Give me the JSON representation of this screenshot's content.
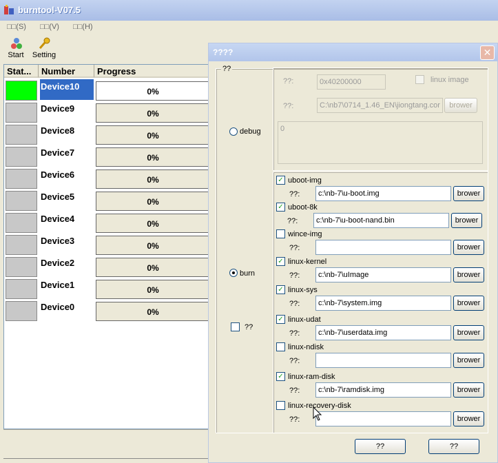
{
  "window": {
    "title": "burntool-V07.5"
  },
  "menu": [
    "□□(S)",
    "□□(V)",
    "□□(H)"
  ],
  "toolbar": {
    "start": "Start",
    "setting": "Setting"
  },
  "table": {
    "headers": [
      "Stat...",
      "Number",
      "Progress"
    ],
    "rows": [
      {
        "name": "Device10",
        "progress": "0%",
        "status_color": "#00ff00"
      },
      {
        "name": "Device9",
        "progress": "0%",
        "status_color": "#c8c8c8"
      },
      {
        "name": "Device8",
        "progress": "0%",
        "status_color": "#c8c8c8"
      },
      {
        "name": "Device7",
        "progress": "0%",
        "status_color": "#c8c8c8"
      },
      {
        "name": "Device6",
        "progress": "0%",
        "status_color": "#c8c8c8"
      },
      {
        "name": "Device5",
        "progress": "0%",
        "status_color": "#c8c8c8"
      },
      {
        "name": "Device4",
        "progress": "0%",
        "status_color": "#c8c8c8"
      },
      {
        "name": "Device3",
        "progress": "0%",
        "status_color": "#c8c8c8"
      },
      {
        "name": "Device2",
        "progress": "0%",
        "status_color": "#c8c8c8"
      },
      {
        "name": "Device1",
        "progress": "0%",
        "status_color": "#c8c8c8"
      },
      {
        "name": "Device0",
        "progress": "0%",
        "status_color": "#c8c8c8"
      }
    ]
  },
  "dialog": {
    "title": "????",
    "group_label": "??",
    "debug": {
      "radio_label": "debug",
      "addr_label": "??:",
      "addr_value": "0x40200000",
      "linux_image_label": "linux image",
      "path_label": "??:",
      "path_value": "C:\\nb7\\0714_1.46_EN\\jiongtang.cor",
      "browse_label": "brower",
      "log_value": "0"
    },
    "burn": {
      "radio_label": "burn",
      "extra_check_label": "??",
      "path_label": "??:",
      "browse_label": "brower",
      "items": [
        {
          "label": "uboot-img",
          "checked": true,
          "path": "c:\\nb-7\\u-boot.img"
        },
        {
          "label": "uboot-8k",
          "checked": true,
          "path": "c:\\nb-7\\u-boot-nand.bin"
        },
        {
          "label": "wince-img",
          "checked": false,
          "path": ""
        },
        {
          "label": "linux-kernel",
          "checked": true,
          "path": "c:\\nb-7\\uImage"
        },
        {
          "label": "linux-sys",
          "checked": true,
          "path": "c:\\nb-7\\system.img"
        },
        {
          "label": "linux-udat",
          "checked": true,
          "path": "c:\\nb-7\\userdata.img"
        },
        {
          "label": "linux-ndisk",
          "checked": false,
          "path": ""
        },
        {
          "label": "linux-ram-disk",
          "checked": true,
          "path": "c:\\nb-7\\ramdisk.img"
        },
        {
          "label": "linux-recovery-disk",
          "checked": false,
          "path": ""
        }
      ]
    },
    "ok_label": "??",
    "cancel_label": "??"
  }
}
